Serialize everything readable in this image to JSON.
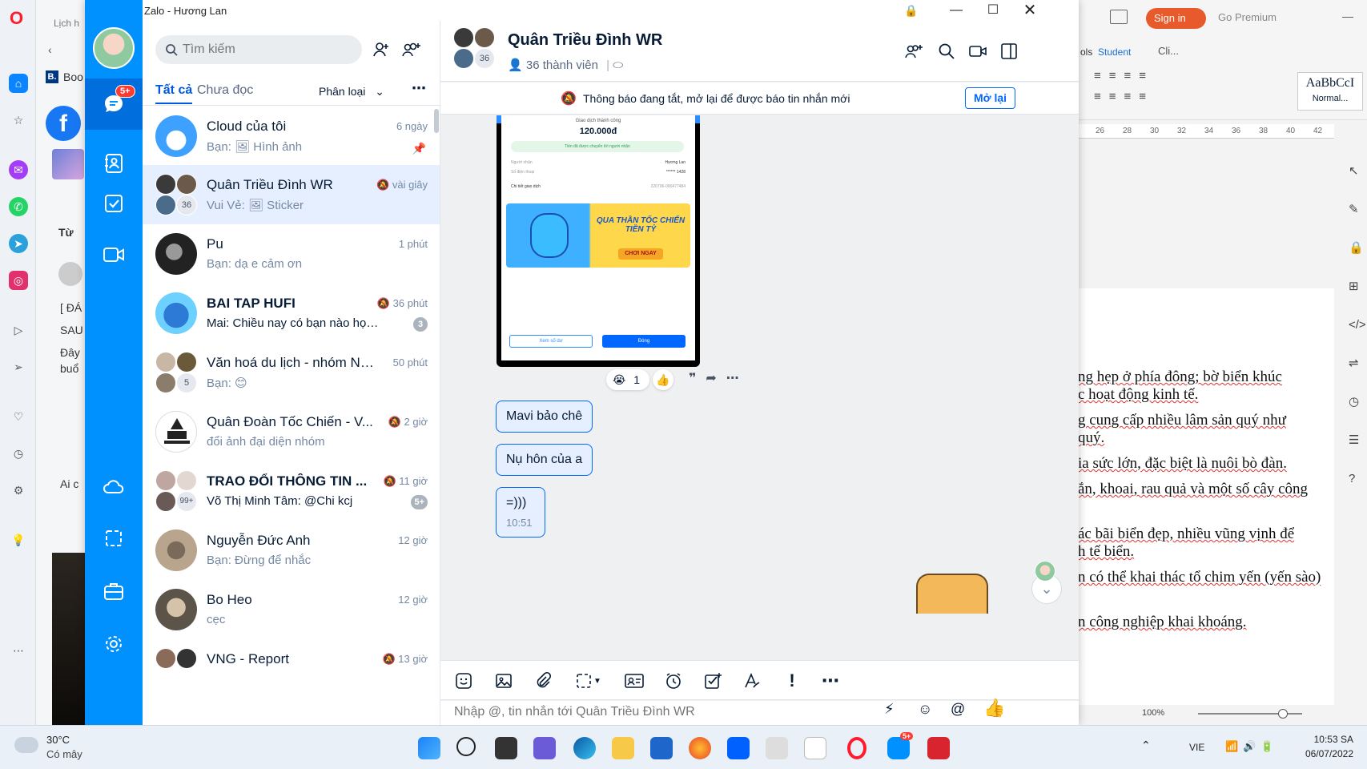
{
  "opera": {
    "tab_label": "Lịch h",
    "bookmark": "Boo",
    "section_label": "Từ",
    "post_lines": [
      "[ ĐÁ",
      "SAU",
      "Đây",
      "buổ",
      "Ai c"
    ]
  },
  "word": {
    "sign_in": "Sign in",
    "go_premium": "Go Premium",
    "tools_tab": "ols",
    "student_tab": "Student",
    "cli_label": "Cli...",
    "style_preview": "AaBbCcI",
    "style_name": "Normal...",
    "ruler_ticks": [
      "26",
      "28",
      "30",
      "32",
      "34",
      "36",
      "38",
      "40",
      "42"
    ],
    "zoom": "100%",
    "body_lines": [
      "ng hẹp ở phía đông; bờ biển khúc",
      "c hoạt động kinh tế.",
      "g cung cấp nhiều lâm sản quý như",
      "quý.",
      "ia sức lớn, đặc biệt là nuôi bò đàn.",
      "ắn, khoai, rau quả và một số cây công",
      "ác bãi biển đẹp, nhiều vũng vịnh để",
      "h tế biển.",
      "n có thể khai thác tổ chim yến (yến sào)",
      "n công nghiệp khai khoáng."
    ]
  },
  "taskbar": {
    "temperature": "30°C",
    "weather": "Có mây",
    "language": "VIE",
    "time": "10:53 SA",
    "date": "06/07/2022",
    "zalo_badge": "5+"
  },
  "zalo": {
    "window_title": "Zalo - Hương Lan",
    "nav": {
      "messages_badge": "5+"
    },
    "search": {
      "placeholder": "Tìm kiếm"
    },
    "tabs": {
      "all": "Tất cả",
      "unread": "Chưa đọc",
      "classify": "Phân loại"
    },
    "conversations": [
      {
        "name": "Cloud của tôi",
        "preview": "Bạn: 🖼 Hình ảnh",
        "time": "6 ngày",
        "badge": ""
      },
      {
        "name": "Quân Triều Đình WR",
        "preview": "Vui Vẻ: 🖼 Sticker",
        "time": "vài giây",
        "badge": "",
        "members": "36"
      },
      {
        "name": "Pu",
        "preview": "Bạn: dạ e cảm ơn",
        "time": "1 phút",
        "badge": ""
      },
      {
        "name": "BAI TAP HUFI",
        "preview": "Mai: Chiều nay có bạn nào học ...",
        "time": "36 phút",
        "badge": "3"
      },
      {
        "name": "Văn hoá du lịch - nhóm Nă...",
        "preview": "Bạn: 😊",
        "time": "50 phút",
        "badge": "",
        "members": "5"
      },
      {
        "name": "Quân Đoàn Tốc Chiến - V...",
        "preview": "đổi ảnh đại diện nhóm",
        "time": "2 giờ",
        "badge": ""
      },
      {
        "name": "TRAO ĐỔI THÔNG TIN ...",
        "preview": "Võ Thị Minh Tâm: @Chi kcj",
        "time": "11 giờ",
        "badge": "5+",
        "members": "99+"
      },
      {
        "name": "Nguyễn Đức Anh",
        "preview": "Bạn: Đừng để nhắc",
        "time": "12 giờ",
        "badge": ""
      },
      {
        "name": "Bo Heo",
        "preview": "cẹc",
        "time": "12 giờ",
        "badge": ""
      },
      {
        "name": "VNG - Report",
        "preview": "",
        "time": "13 giờ",
        "badge": ""
      }
    ],
    "chat": {
      "title": "Quân Triều Đình WR",
      "member_count": "36",
      "members_label": "36 thành viên",
      "notice": "Thông báo đang tắt, mở lại để được báo tin nhắn mới",
      "reopen": "Mở lại",
      "screenshot": {
        "status": "Giao dịch thành công",
        "amount": "120.000đ",
        "transfer_note": "Tiền đã được chuyển tới người nhận",
        "recipient_label": "Người nhận",
        "recipient": "Hương Lan",
        "phone_label": "Số điện thoại",
        "phone": "****** 1428",
        "detail_label": "Chi tiết giao dịch",
        "detail_id": "220706-000477484",
        "banner_title": "QUA THẦN TỐC CHIẾN TIỀN TỶ",
        "banner_cta": "CHƠI NGAY",
        "btn_balance": "Xem số dư",
        "btn_close": "Đóng"
      },
      "reaction_count": "1",
      "messages": [
        {
          "text": "Mavi bảo chê",
          "time": ""
        },
        {
          "text": "Nụ hôn của a",
          "time": ""
        },
        {
          "text": "=)))",
          "time": "10:51"
        }
      ],
      "composer_placeholder": "Nhập @, tin nhắn tới Quân Triều Đình WR"
    }
  }
}
